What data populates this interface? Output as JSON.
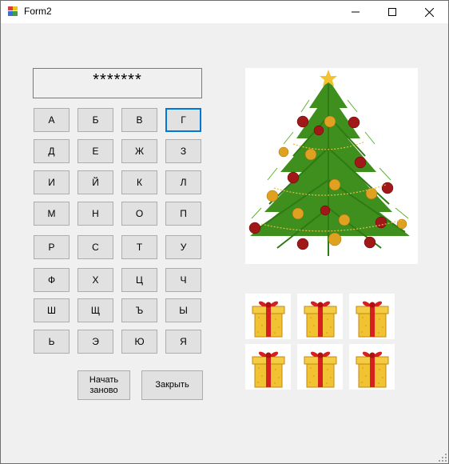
{
  "window": {
    "title": "Form2"
  },
  "display": {
    "masked_word": "*******"
  },
  "keys": [
    "А",
    "Б",
    "В",
    "Г",
    "Д",
    "Е",
    "Ж",
    "З",
    "И",
    "Й",
    "К",
    "Л",
    "М",
    "Н",
    "О",
    "П",
    "Р",
    "С",
    "Т",
    "У",
    "Ф",
    "Х",
    "Ц",
    "Ч",
    "Ш",
    "Щ",
    "Ъ",
    "Ы",
    "Ь",
    "Э",
    "Ю",
    "Я"
  ],
  "buttons": {
    "restart": "Начать заново",
    "close": "Закрыть"
  },
  "colors": {
    "focus": "#0078d7",
    "button_face": "#e1e1e1",
    "window_bg": "#f0f0f0"
  }
}
